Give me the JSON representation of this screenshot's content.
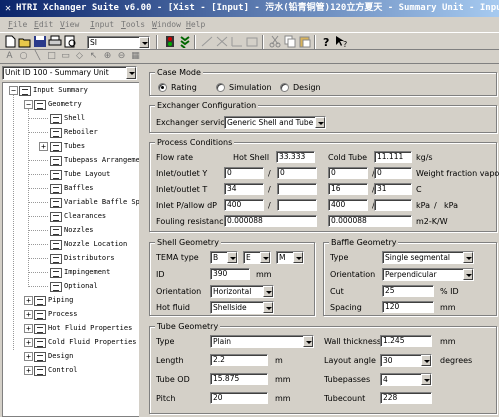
{
  "window": {
    "title": "HTRI Xchanger Suite v6.00 - [Xist - [Input] - 污水(铅青铜管)120立方夏天 - Summary Unit - Input Summary]"
  },
  "menu": [
    "File",
    "Edit",
    "View",
    "Input",
    "Tools",
    "Window",
    "Help"
  ],
  "toolbar": {
    "unit_select": "SI"
  },
  "tree": {
    "unit_select": "Unit ID 100 - Summary Unit",
    "items": [
      {
        "label": "Input Summary"
      },
      {
        "label": "Geometry"
      },
      {
        "label": "Shell"
      },
      {
        "label": "Reboiler"
      },
      {
        "label": "Tubes"
      },
      {
        "label": "Tubepass Arrangement"
      },
      {
        "label": "Tube Layout"
      },
      {
        "label": "Baffles"
      },
      {
        "label": "Variable Baffle Spacing"
      },
      {
        "label": "Clearances"
      },
      {
        "label": "Nozzles"
      },
      {
        "label": "Nozzle Location"
      },
      {
        "label": "Distributors"
      },
      {
        "label": "Impingement"
      },
      {
        "label": "Optional"
      },
      {
        "label": "Piping"
      },
      {
        "label": "Process"
      },
      {
        "label": "Hot Fluid Properties"
      },
      {
        "label": "Cold Fluid Properties"
      },
      {
        "label": "Design"
      },
      {
        "label": "Control"
      }
    ]
  },
  "case_mode": {
    "title": "Case Mode",
    "options": [
      "Rating",
      "Simulation",
      "Design"
    ],
    "selected": "Rating"
  },
  "exchanger_config": {
    "title": "Exchanger Configuration",
    "service_label": "Exchanger service",
    "service_value": "Generic Shell and Tube"
  },
  "process": {
    "title": "Process Conditions",
    "flow_rate_label": "Flow rate",
    "hot_shell_label": "Hot Shell",
    "hot_flow": "33.333",
    "cold_tube_label": "Cold Tube",
    "cold_flow": "11.111",
    "flow_unit": "kg/s",
    "inlet_y_label": "Inlet/outlet Y",
    "hot_in_y": "0",
    "hot_out_y": "0",
    "cold_in_y": "0",
    "cold_out_y": "0",
    "y_unit": "Weight fraction vapor",
    "inlet_t_label": "Inlet/outlet T",
    "hot_in_t": "34",
    "hot_out_t": "",
    "cold_in_t": "16",
    "cold_out_t": "31",
    "t_unit": "C",
    "pressure_label": "Inlet P/allow dP",
    "hot_p": "400",
    "hot_dp": "",
    "cold_p": "400",
    "cold_dp": "",
    "p_unit": "kPa",
    "dp_unit": "kPa",
    "fouling_label": "Fouling resistance",
    "hot_fouling": "0.000088",
    "cold_fouling": "0.000088",
    "fouling_unit": "m2-K/W",
    "slash": "/"
  },
  "shell_geometry": {
    "title": "Shell Geometry",
    "tema_label": "TEMA type",
    "tema_front": "B",
    "tema_shell": "E",
    "tema_rear": "M",
    "id_label": "ID",
    "id_value": "390",
    "id_unit": "mm",
    "orientation_label": "Orientation",
    "orientation_value": "Horizontal",
    "hot_fluid_label": "Hot fluid",
    "hot_fluid_value": "Shellside"
  },
  "baffle_geometry": {
    "title": "Baffle Geometry",
    "type_label": "Type",
    "type_value": "Single segmental",
    "orientation_label": "Orientation",
    "orientation_value": "Perpendicular",
    "cut_label": "Cut",
    "cut_value": "25",
    "cut_unit": "% ID",
    "spacing_label": "Spacing",
    "spacing_value": "120",
    "spacing_unit": "mm"
  },
  "tube_geometry": {
    "title": "Tube Geometry",
    "type_label": "Type",
    "type_value": "Plain",
    "length_label": "Length",
    "length_value": "2.2",
    "length_unit": "m",
    "od_label": "Tube OD",
    "od_value": "15.875",
    "od_unit": "mm",
    "pitch_label": "Pitch",
    "pitch_value": "20",
    "pitch_unit": "mm",
    "wall_label": "Wall thickness",
    "wall_value": "1.245",
    "wall_unit": "mm",
    "layout_label": "Layout angle",
    "layout_value": "30",
    "layout_unit": "degrees",
    "passes_label": "Tubepasses",
    "passes_value": "4",
    "count_label": "Tubecount",
    "count_value": "228"
  }
}
